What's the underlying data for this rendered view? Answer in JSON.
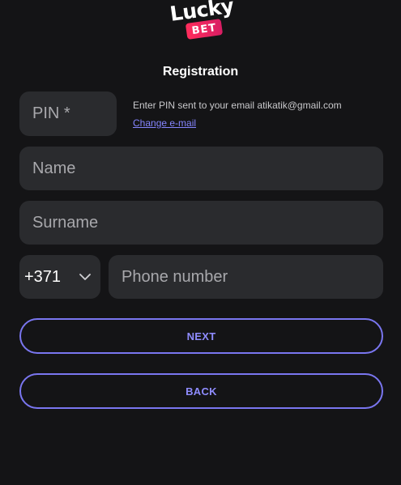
{
  "brand": {
    "word": "Lucky",
    "badge": "BET"
  },
  "form": {
    "title": "Registration",
    "pin": {
      "placeholder": "PIN *",
      "hint": "Enter PIN sent to your email atikatik@gmail.com",
      "change_email_link": "Change e-mail"
    },
    "name": {
      "placeholder": "Name"
    },
    "surname": {
      "placeholder": "Surname"
    },
    "phone": {
      "country_code": "+371",
      "placeholder": "Phone number"
    },
    "next_label": "NEXT",
    "back_label": "BACK"
  },
  "icons": {
    "country_dropdown": "chevron-down-icon"
  },
  "colors": {
    "background": "#141416",
    "field": "#2a2b2e",
    "accent": "#7a76f0",
    "link": "#8585ff",
    "brand_badge": "#ff2d5c"
  }
}
